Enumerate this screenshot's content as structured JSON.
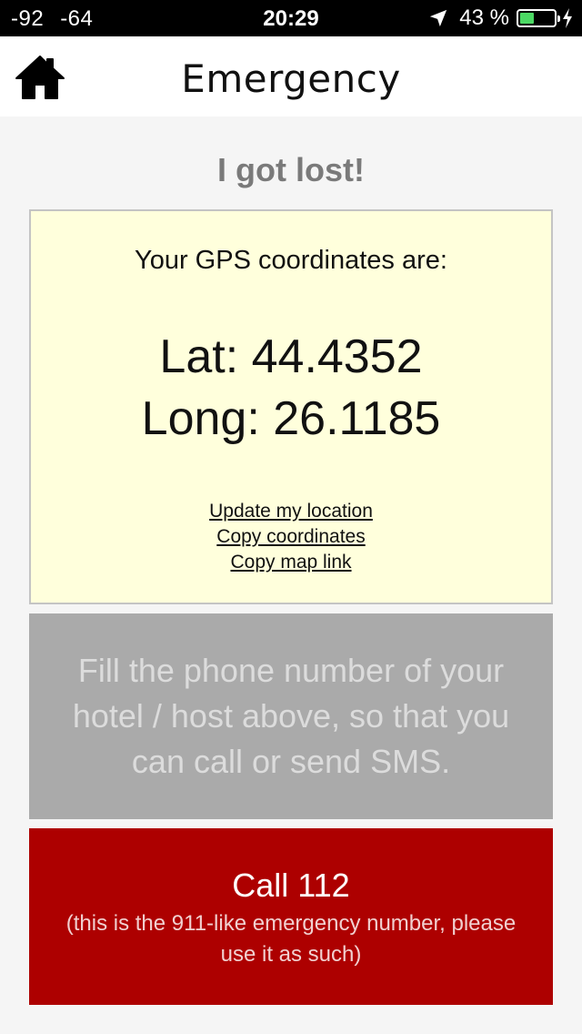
{
  "status_bar": {
    "signal_left_1": "-92",
    "signal_left_2": "-64",
    "time": "20:29",
    "battery_percent": "43 %",
    "battery_level": 0.43,
    "icons": [
      "location-arrow-icon",
      "battery-icon",
      "charging-bolt-icon"
    ]
  },
  "nav": {
    "title": "Emergency",
    "home_icon": "home-icon"
  },
  "main": {
    "heading": "I got lost!",
    "gps": {
      "intro": "Your GPS coordinates are:",
      "lat_text": "Lat: 44.4352",
      "long_text": "Long: 26.1185",
      "links": {
        "update": "Update my location",
        "copy_coords": "Copy coordinates",
        "copy_map": "Copy map link"
      }
    },
    "sms_panel": {
      "text": "Fill the phone number of your hotel / host above, so that you can call or send SMS."
    },
    "call": {
      "title": "Call 112",
      "note": "(this is the 911-like emergency number, please use it as such)"
    }
  },
  "colors": {
    "gps_box_bg": "#ffffdc",
    "sms_panel_bg": "#aaaaaa",
    "call_button_bg": "#ad0000",
    "heading_text": "#7a7a7a"
  }
}
